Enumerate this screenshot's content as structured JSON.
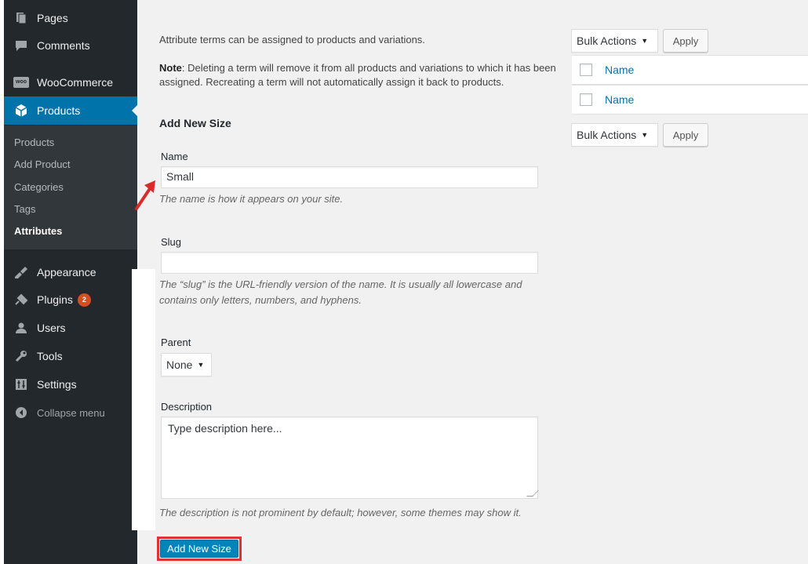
{
  "sidebar": {
    "items": [
      {
        "label": "Pages",
        "icon": "pages-icon"
      },
      {
        "label": "Comments",
        "icon": "comments-icon"
      },
      {
        "label": "WooCommerce",
        "icon": "woocommerce-icon"
      },
      {
        "label": "Products",
        "icon": "products-icon"
      },
      {
        "label": "Appearance",
        "icon": "appearance-icon"
      },
      {
        "label": "Plugins",
        "icon": "plugins-icon",
        "badge": "2"
      },
      {
        "label": "Users",
        "icon": "users-icon"
      },
      {
        "label": "Tools",
        "icon": "tools-icon"
      },
      {
        "label": "Settings",
        "icon": "settings-icon"
      }
    ],
    "submenu": [
      "Products",
      "Add Product",
      "Categories",
      "Tags",
      "Attributes"
    ],
    "collapse_label": "Collapse menu",
    "woo_icon_text": "woo"
  },
  "form": {
    "intro": "Attribute terms can be assigned to products and variations.",
    "note_label": "Note",
    "note_text": ": Deleting a term will remove it from all products and variations to which it has been assigned. Recreating a term will not automatically assign it back to products.",
    "heading": "Add New Size",
    "name_label": "Name",
    "name_value": "Small",
    "name_help": "The name is how it appears on your site.",
    "slug_label": "Slug",
    "slug_value": "",
    "slug_help": "The “slug” is the URL-friendly version of the name. It is usually all lowercase and contains only letters, numbers, and hyphens.",
    "parent_label": "Parent",
    "parent_value": "None",
    "description_label": "Description",
    "description_value": "Type description here...",
    "description_help": "The description is not prominent by default; however, some themes may show it.",
    "submit_label": "Add New Size"
  },
  "table": {
    "bulk_actions_label": "Bulk Actions",
    "apply_label": "Apply",
    "column_name": "Name"
  },
  "colors": {
    "sidebar_bg": "#23282d",
    "active_bg": "#0073aa",
    "primary_button": "#0085ba",
    "highlight_red": "#dd3333",
    "badge": "#d54e21"
  }
}
